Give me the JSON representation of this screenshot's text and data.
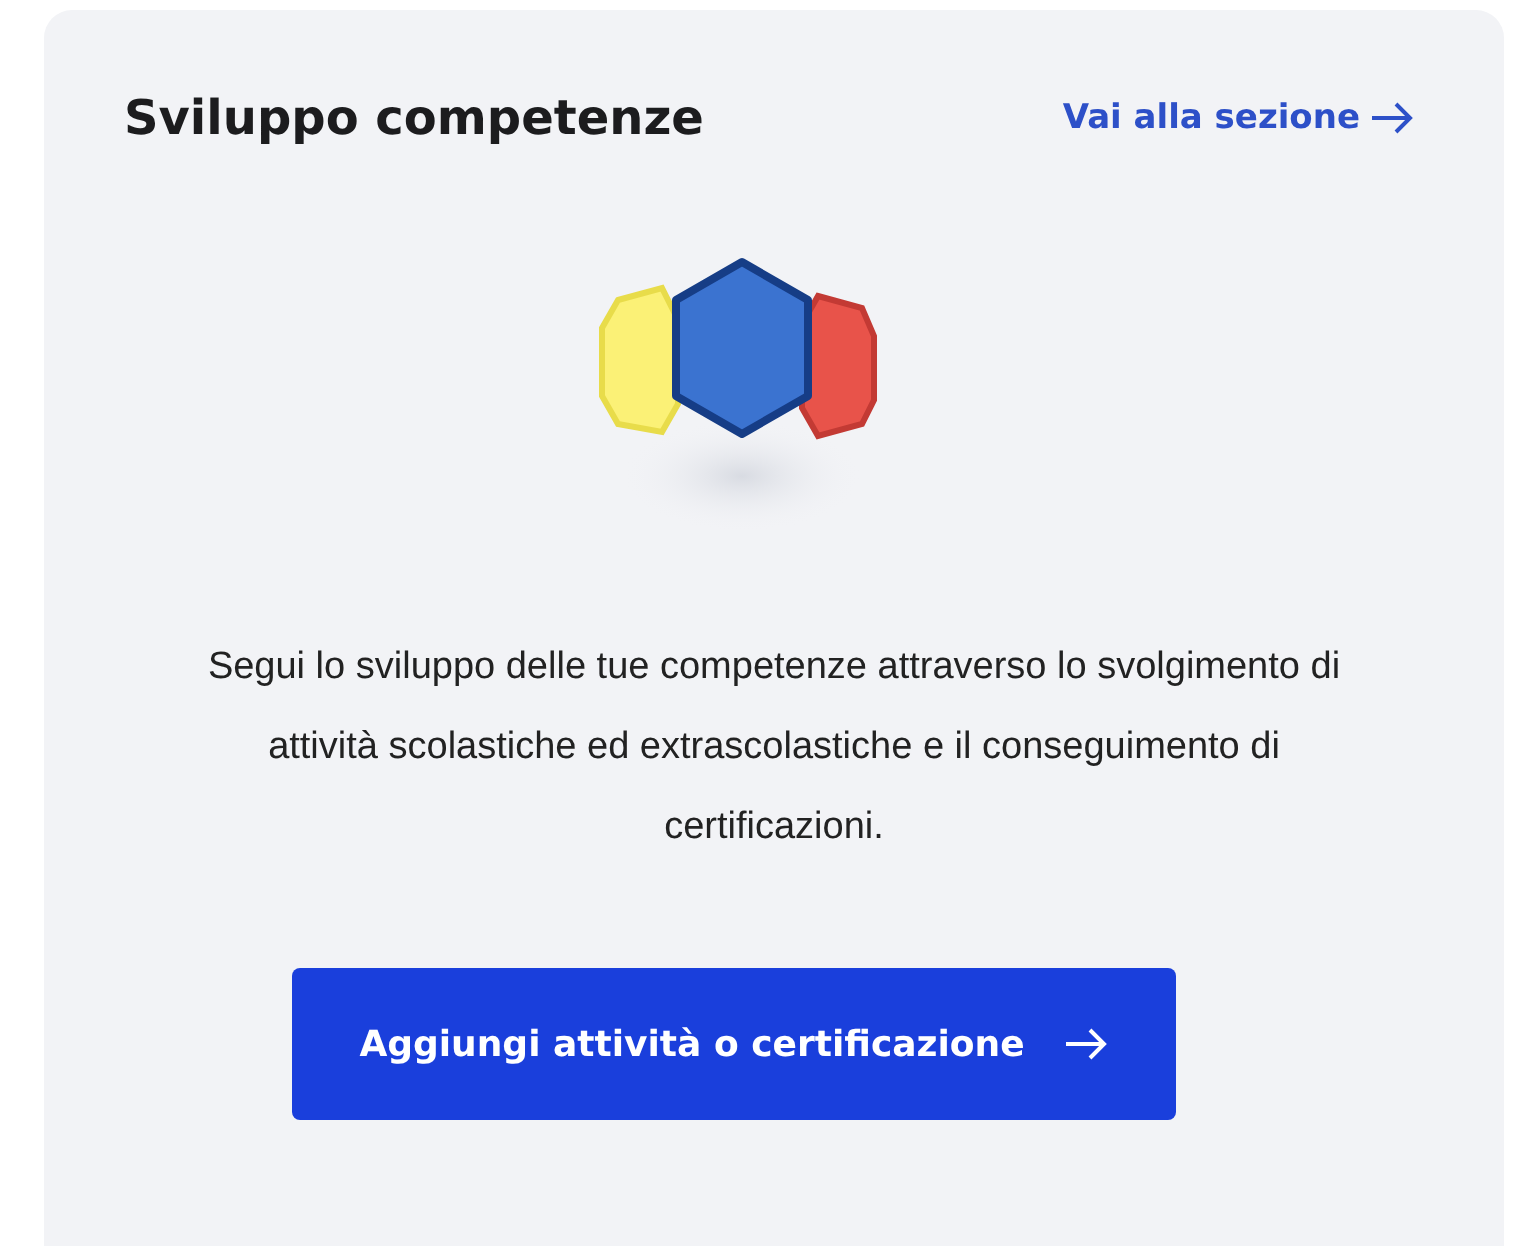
{
  "card": {
    "title": "Sviluppo competenze",
    "link": "Vai alla sezione",
    "description": "Segui lo sviluppo delle tue competenze attraverso lo svolgimento di attività scolastiche ed extrascolastiche e il conseguimento di certificazioni.",
    "button": "Aggiungi attività o certificazione"
  }
}
